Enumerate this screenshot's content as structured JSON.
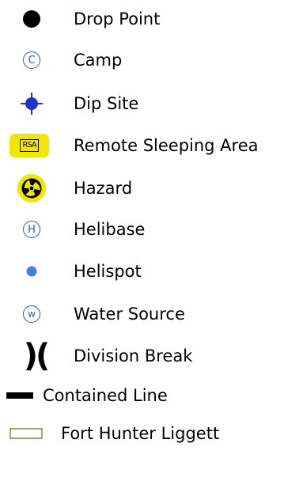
{
  "legend": {
    "items": [
      {
        "label": "Drop Point",
        "icon": "filled-black-circle-icon"
      },
      {
        "label": "Camp",
        "icon": "circled-c-icon",
        "glyph": "C",
        "color": "#2b55d6"
      },
      {
        "label": "Dip Site",
        "icon": "crosshair-target-icon",
        "color": "#2033c9"
      },
      {
        "label": "Remote Sleeping Area",
        "icon": "rsa-badge-icon",
        "badge_text": "RSA",
        "color": "#f2e600"
      },
      {
        "label": "Hazard",
        "icon": "radiation-hazard-icon",
        "color": "#f2e600"
      },
      {
        "label": "Helibase",
        "icon": "circled-h-icon",
        "glyph": "H",
        "color": "#2b55d6"
      },
      {
        "label": "Helispot",
        "icon": "blue-dot-icon",
        "color": "#4a7de0"
      },
      {
        "label": "Water Source",
        "icon": "circled-w-icon",
        "glyph": "w",
        "color": "#2b55d6"
      },
      {
        "label": "Division Break",
        "icon": "opposed-parentheses-icon",
        "glyph": ")("
      },
      {
        "label": "Contained Line",
        "icon": "solid-black-line-icon"
      },
      {
        "label": "Fort Hunter Liggett",
        "icon": "tan-outlined-rectangle-icon",
        "color": "#a07b3c"
      }
    ]
  }
}
